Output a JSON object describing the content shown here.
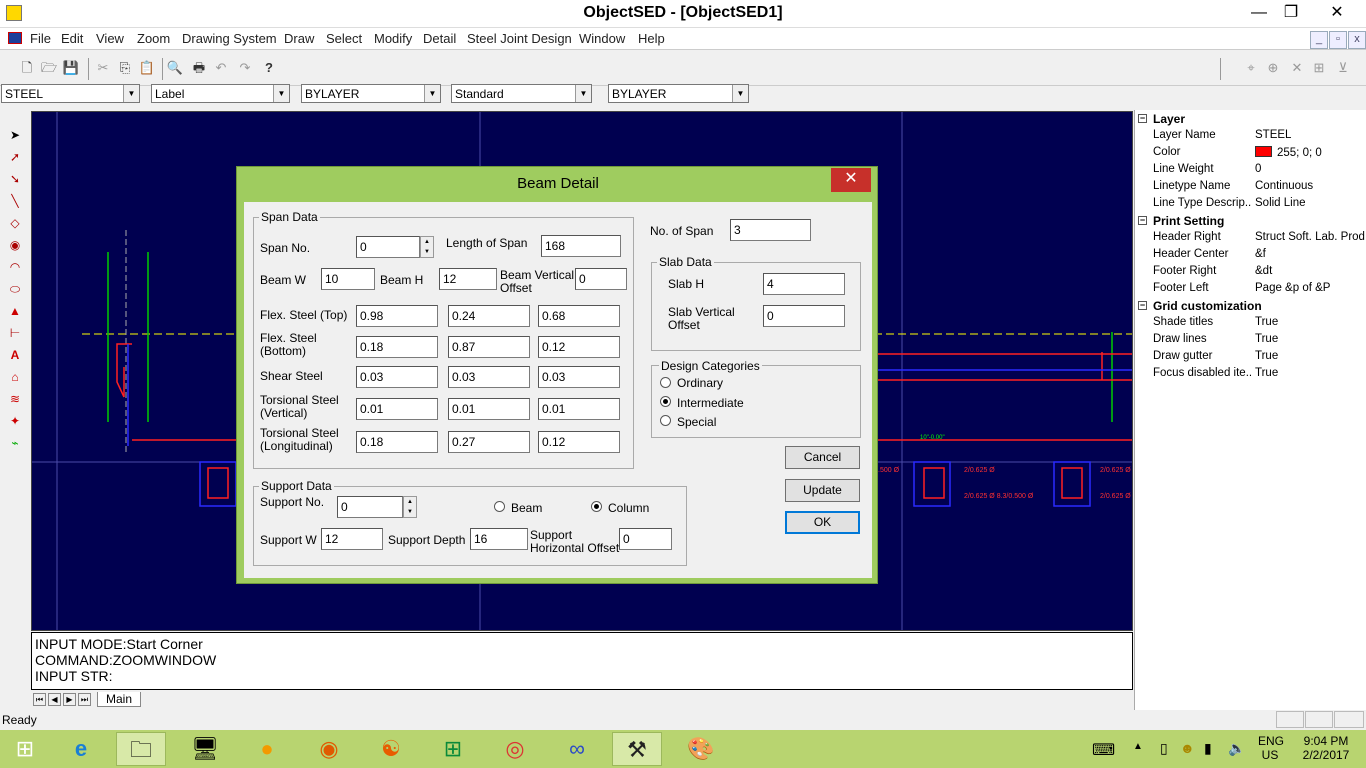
{
  "window": {
    "title": "ObjectSED - [ObjectSED1]",
    "minimize": "—",
    "maximize": "❐",
    "close": "✕"
  },
  "menu": [
    "File",
    "Edit",
    "View",
    "Zoom",
    "Drawing System",
    "Draw",
    "Select",
    "Modify",
    "Detail",
    "Steel Joint Design",
    "Window",
    "Help"
  ],
  "combos": {
    "layer": "STEEL",
    "style": "Label",
    "color": "BYLAYER",
    "textstyle": "Standard",
    "linetype": "BYLAYER"
  },
  "command": {
    "line1": "INPUT MODE:Start Corner",
    "line2": "COMMAND:ZOOMWINDOW",
    "line3": "INPUT STR:"
  },
  "tabs": {
    "main": "Main"
  },
  "status": {
    "text": "Ready"
  },
  "properties": [
    {
      "type": "cat",
      "key": "Layer"
    },
    {
      "key": "Layer Name",
      "value": "STEEL"
    },
    {
      "key": "Color",
      "value": "255; 0; 0",
      "swatch": "#ff0000"
    },
    {
      "key": "Line Weight",
      "value": "0"
    },
    {
      "key": "Linetype Name",
      "value": "Continuous"
    },
    {
      "key": "Line Type Descrip...",
      "value": "Solid Line"
    },
    {
      "type": "cat",
      "key": "Print Setting"
    },
    {
      "key": "Header Right",
      "value": "Struct Soft. Lab. Prod..."
    },
    {
      "key": "Header Center",
      "value": "&f"
    },
    {
      "key": "Footer Right",
      "value": "&dt"
    },
    {
      "key": "Footer Left",
      "value": "Page &p of &P"
    },
    {
      "type": "cat",
      "key": "Grid customization"
    },
    {
      "key": "Shade titles",
      "value": "True"
    },
    {
      "key": "Draw lines",
      "value": "True"
    },
    {
      "key": "Draw gutter",
      "value": "True"
    },
    {
      "key": "Focus disabled ite...",
      "value": "True"
    }
  ],
  "dialog": {
    "title": "Beam Detail",
    "close": "✕",
    "span_data": {
      "label": "Span Data",
      "span_no_label": "Span No.",
      "span_no": "0",
      "length_label": "Length of Span",
      "length": "168",
      "beam_w_label": "Beam W",
      "beam_w": "10",
      "beam_h_label": "Beam H",
      "beam_h": "12",
      "vert_offset_label1": "Beam Vertical",
      "vert_offset_label2": "Offset",
      "vert_offset": "0",
      "rows": [
        {
          "label1": "Flex. Steel (Top)",
          "label2": "",
          "v": [
            "0.98",
            "0.24",
            "0.68"
          ]
        },
        {
          "label1": "Flex. Steel",
          "label2": "(Bottom)",
          "v": [
            "0.18",
            "0.87",
            "0.12"
          ]
        },
        {
          "label1": "Shear Steel",
          "label2": "",
          "v": [
            "0.03",
            "0.03",
            "0.03"
          ]
        },
        {
          "label1": "Torsional Steel",
          "label2": "(Vertical)",
          "v": [
            "0.01",
            "0.01",
            "0.01"
          ]
        },
        {
          "label1": "Torsional Steel",
          "label2": "(Longitudinal)",
          "v": [
            "0.18",
            "0.27",
            "0.12"
          ]
        }
      ]
    },
    "no_of_span_label": "No. of Span",
    "no_of_span": "3",
    "slab": {
      "label": "Slab Data",
      "h_label": "Slab H",
      "h": "4",
      "offset_label1": "Slab Vertical",
      "offset_label2": "Offset",
      "offset": "0"
    },
    "design": {
      "label": "Design Categories",
      "options": [
        "Ordinary",
        "Intermediate",
        "Special"
      ],
      "selected": "Intermediate"
    },
    "support": {
      "label": "Support Data",
      "no_label": "Support No.",
      "no": "0",
      "beam": "Beam",
      "column": "Column",
      "selected": "Column",
      "w_label": "Support W",
      "w": "12",
      "depth_label": "Support Depth",
      "depth": "16",
      "hoffset_label1": "Support",
      "hoffset_label2": "Horizontal Offset",
      "hoffset": "0"
    },
    "buttons": {
      "cancel": "Cancel",
      "update": "Update",
      "ok": "OK"
    }
  },
  "tray": {
    "lang1": "ENG",
    "lang2": "US",
    "time": "9:04 PM",
    "date": "2/2/2017"
  }
}
